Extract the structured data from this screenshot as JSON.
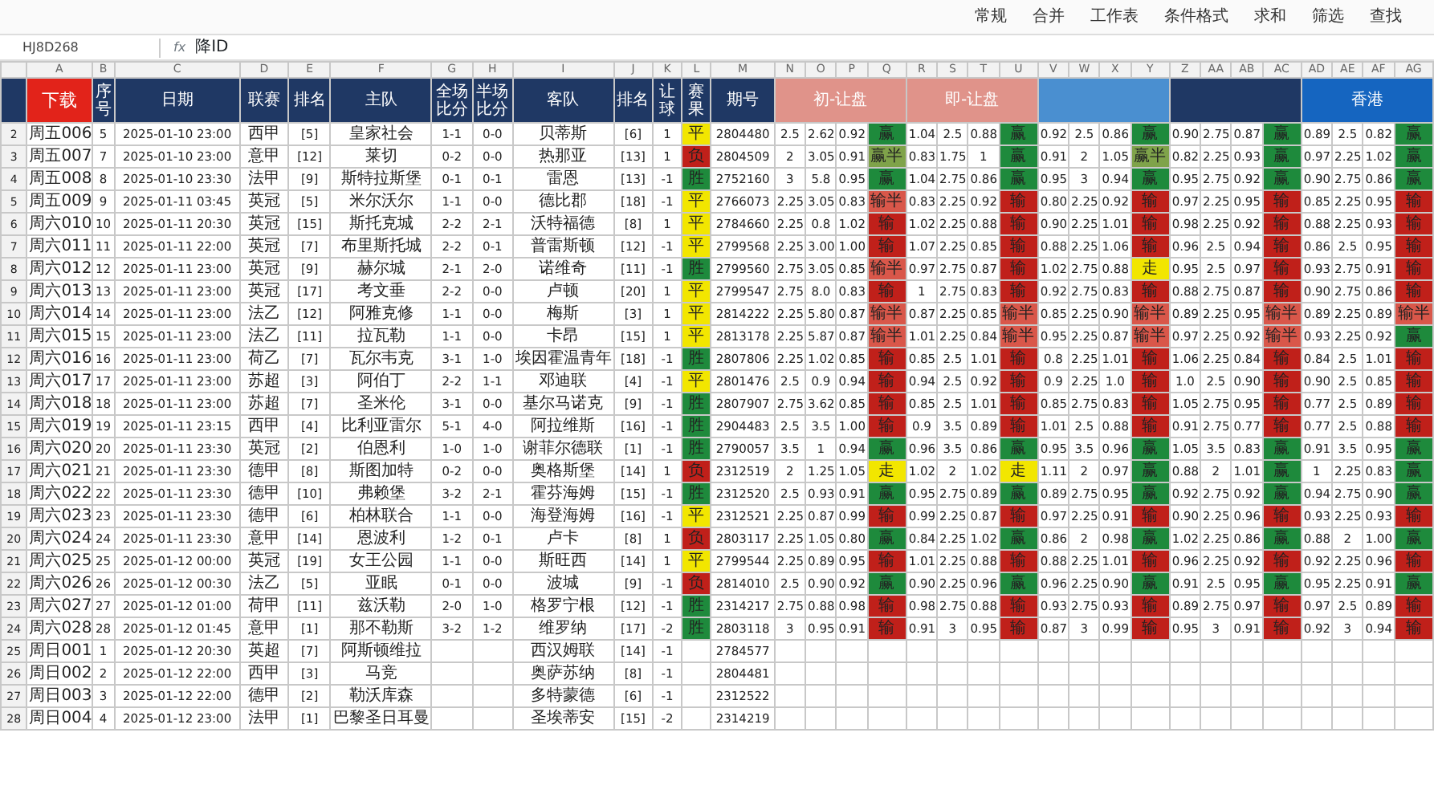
{
  "toolbar": {
    "items": [
      "常规",
      "合并",
      "工作表",
      "条件格式",
      "求和",
      "筛选",
      "查找"
    ]
  },
  "formula_bar": {
    "name_box": "HJ8D268",
    "fx": "fx",
    "value": "降ID"
  },
  "col_letters": [
    "A",
    "B",
    "C",
    "D",
    "E",
    "F",
    "G",
    "H",
    "I",
    "J",
    "K",
    "L",
    "M",
    "N",
    "O",
    "P",
    "Q",
    "R",
    "S",
    "T",
    "U",
    "V",
    "W",
    "X",
    "Y",
    "Z",
    "AA",
    "AB",
    "AC",
    "AD",
    "AE",
    "AF",
    "AG"
  ],
  "header": {
    "download": "下载",
    "columns": [
      "序号",
      "日期",
      "联赛",
      "排名",
      "主队",
      "全场比分",
      "半场比分",
      "客队",
      "排名",
      "让球",
      "赛果",
      "期号"
    ],
    "groups": [
      {
        "label": "初-让盘",
        "color": "#e0938a"
      },
      {
        "label": "即-让盘",
        "color": "#e0938a"
      },
      {
        "color": "#4a8fd0"
      },
      {
        "color": "#1f3864"
      },
      {
        "label": "香港",
        "color": "#1565c0"
      }
    ]
  },
  "rows": [
    {
      "n": "2",
      "code": "周五006",
      "no": "5",
      "date": "2025-01-10 23:00",
      "lg": "西甲",
      "hr": "[5]",
      "home": "皇家社会",
      "ft": "1-1",
      "ht": "0-0",
      "away": "贝蒂斯",
      "ar": "[6]",
      "hcp": "1",
      "result": {
        "t": "平",
        "color": "#f2e600"
      },
      "issue": "2804480",
      "g": [
        {
          "v": [
            "2.5",
            "2.62",
            "0.92"
          ],
          "t": "赢",
          "color": "#1e8a3c"
        },
        {
          "v": [
            "1.04",
            "2.5",
            "0.88"
          ],
          "t": "赢",
          "color": "#1e8a3c"
        },
        {
          "v": [
            "0.92",
            "2.5",
            "0.86"
          ],
          "t": "赢",
          "color": "#1e8a3c"
        },
        {
          "v": [
            "0.90",
            "2.75",
            "0.87"
          ],
          "t": "赢",
          "color": "#1e8a3c"
        },
        {
          "v": [
            "0.89",
            "2.5",
            "0.82"
          ],
          "t": "赢",
          "color": "#1e8a3c"
        }
      ]
    },
    {
      "n": "3",
      "code": "周五007",
      "no": "7",
      "date": "2025-01-10 23:00",
      "lg": "意甲",
      "hr": "[12]",
      "home": "莱切",
      "ft": "0-2",
      "ht": "0-0",
      "away": "热那亚",
      "ar": "[13]",
      "hcp": "1",
      "result": {
        "t": "负",
        "color": "#c0201a"
      },
      "issue": "2804509",
      "g": [
        {
          "v": [
            "2",
            "3.05",
            "0.91"
          ],
          "t": "赢半",
          "color": "#7fa34a"
        },
        {
          "v": [
            "0.83",
            "1.75",
            "1"
          ],
          "t": "赢",
          "color": "#1e8a3c"
        },
        {
          "v": [
            "0.91",
            "2",
            "1.05"
          ],
          "t": "赢半",
          "color": "#7fa34a"
        },
        {
          "v": [
            "0.82",
            "2.25",
            "0.93"
          ],
          "t": "赢",
          "color": "#1e8a3c"
        },
        {
          "v": [
            "0.97",
            "2.25",
            "1.02"
          ],
          "t": "赢",
          "color": "#1e8a3c"
        }
      ]
    },
    {
      "n": "4",
      "code": "周五008",
      "no": "8",
      "date": "2025-01-10 23:30",
      "lg": "法甲",
      "hr": "[9]",
      "home": "斯特拉斯堡",
      "ft": "0-1",
      "ht": "0-1",
      "away": "雷恩",
      "ar": "[13]",
      "hcp": "-1",
      "result": {
        "t": "胜",
        "color": "#1e8a3c"
      },
      "issue": "2752160",
      "g": [
        {
          "v": [
            "3",
            "5.8",
            "0.95"
          ],
          "t": "赢",
          "color": "#1e8a3c"
        },
        {
          "v": [
            "1.04",
            "2.75",
            "0.86"
          ],
          "t": "赢",
          "color": "#1e8a3c"
        },
        {
          "v": [
            "0.95",
            "3",
            "0.94"
          ],
          "t": "赢",
          "color": "#1e8a3c"
        },
        {
          "v": [
            "0.95",
            "2.75",
            "0.92"
          ],
          "t": "赢",
          "color": "#1e8a3c"
        },
        {
          "v": [
            "0.90",
            "2.75",
            "0.86"
          ],
          "t": "赢",
          "color": "#1e8a3c"
        }
      ]
    },
    {
      "n": "5",
      "code": "周五009",
      "no": "9",
      "date": "2025-01-11 03:45",
      "lg": "英冠",
      "hr": "[5]",
      "home": "米尔沃尔",
      "ft": "1-1",
      "ht": "0-0",
      "away": "德比郡",
      "ar": "[18]",
      "hcp": "-1",
      "result": {
        "t": "平",
        "color": "#f2e600"
      },
      "issue": "2766073",
      "g": [
        {
          "v": [
            "2.25",
            "3.05",
            "0.83"
          ],
          "t": "输半",
          "color": "#d9574a"
        },
        {
          "v": [
            "0.83",
            "2.25",
            "0.92"
          ],
          "t": "输",
          "color": "#c0201a"
        },
        {
          "v": [
            "0.80",
            "2.25",
            "0.92"
          ],
          "t": "输",
          "color": "#c0201a"
        },
        {
          "v": [
            "0.97",
            "2.25",
            "0.95"
          ],
          "t": "输",
          "color": "#c0201a"
        },
        {
          "v": [
            "0.85",
            "2.25",
            "0.95"
          ],
          "t": "输",
          "color": "#c0201a"
        }
      ]
    },
    {
      "n": "6",
      "code": "周六010",
      "no": "10",
      "date": "2025-01-11 20:30",
      "lg": "英冠",
      "hr": "[15]",
      "home": "斯托克城",
      "ft": "2-2",
      "ht": "2-1",
      "away": "沃特福德",
      "ar": "[8]",
      "hcp": "1",
      "result": {
        "t": "平",
        "color": "#f2e600"
      },
      "issue": "2784660",
      "g": [
        {
          "v": [
            "2.25",
            "0.8",
            "1.02"
          ],
          "t": "输",
          "color": "#c0201a"
        },
        {
          "v": [
            "1.02",
            "2.25",
            "0.88"
          ],
          "t": "输",
          "color": "#c0201a"
        },
        {
          "v": [
            "0.90",
            "2.25",
            "1.01"
          ],
          "t": "输",
          "color": "#c0201a"
        },
        {
          "v": [
            "0.98",
            "2.25",
            "0.92"
          ],
          "t": "输",
          "color": "#c0201a"
        },
        {
          "v": [
            "0.88",
            "2.25",
            "0.93"
          ],
          "t": "输",
          "color": "#c0201a"
        }
      ]
    },
    {
      "n": "7",
      "code": "周六011",
      "no": "11",
      "date": "2025-01-11 22:00",
      "lg": "英冠",
      "hr": "[7]",
      "home": "布里斯托城",
      "ft": "2-2",
      "ht": "0-1",
      "away": "普雷斯顿",
      "ar": "[12]",
      "hcp": "-1",
      "result": {
        "t": "平",
        "color": "#f2e600"
      },
      "issue": "2799568",
      "g": [
        {
          "v": [
            "2.25",
            "3.00",
            "1.00"
          ],
          "t": "输",
          "color": "#c0201a"
        },
        {
          "v": [
            "1.07",
            "2.25",
            "0.85"
          ],
          "t": "输",
          "color": "#c0201a"
        },
        {
          "v": [
            "0.88",
            "2.25",
            "1.06"
          ],
          "t": "输",
          "color": "#c0201a"
        },
        {
          "v": [
            "0.96",
            "2.5",
            "0.94"
          ],
          "t": "输",
          "color": "#c0201a"
        },
        {
          "v": [
            "0.86",
            "2.5",
            "0.95"
          ],
          "t": "输",
          "color": "#c0201a"
        }
      ]
    },
    {
      "n": "8",
      "code": "周六012",
      "no": "12",
      "date": "2025-01-11 23:00",
      "lg": "英冠",
      "hr": "[9]",
      "home": "赫尔城",
      "ft": "2-1",
      "ht": "2-0",
      "away": "诺维奇",
      "ar": "[11]",
      "hcp": "-1",
      "result": {
        "t": "胜",
        "color": "#1e8a3c"
      },
      "issue": "2799560",
      "g": [
        {
          "v": [
            "2.75",
            "3.05",
            "0.85"
          ],
          "t": "输半",
          "color": "#d9574a"
        },
        {
          "v": [
            "0.97",
            "2.75",
            "0.87"
          ],
          "t": "输",
          "color": "#c0201a"
        },
        {
          "v": [
            "1.02",
            "2.75",
            "0.88"
          ],
          "t": "走",
          "color": "#f2e600"
        },
        {
          "v": [
            "0.95",
            "2.5",
            "0.97"
          ],
          "t": "输",
          "color": "#c0201a"
        },
        {
          "v": [
            "0.93",
            "2.75",
            "0.91"
          ],
          "t": "输",
          "color": "#c0201a"
        }
      ]
    },
    {
      "n": "9",
      "code": "周六013",
      "no": "13",
      "date": "2025-01-11 23:00",
      "lg": "英冠",
      "hr": "[17]",
      "home": "考文垂",
      "ft": "2-2",
      "ht": "0-0",
      "away": "卢顿",
      "ar": "[20]",
      "hcp": "1",
      "result": {
        "t": "平",
        "color": "#f2e600"
      },
      "issue": "2799547",
      "g": [
        {
          "v": [
            "2.75",
            "8.0",
            "0.83"
          ],
          "t": "输",
          "color": "#c0201a"
        },
        {
          "v": [
            "1",
            "2.75",
            "0.83"
          ],
          "t": "输",
          "color": "#c0201a"
        },
        {
          "v": [
            "0.92",
            "2.75",
            "0.83"
          ],
          "t": "输",
          "color": "#c0201a"
        },
        {
          "v": [
            "0.88",
            "2.75",
            "0.87"
          ],
          "t": "输",
          "color": "#c0201a"
        },
        {
          "v": [
            "0.90",
            "2.75",
            "0.86"
          ],
          "t": "输",
          "color": "#c0201a"
        }
      ]
    },
    {
      "n": "10",
      "code": "周六014",
      "no": "14",
      "date": "2025-01-11 23:00",
      "lg": "法乙",
      "hr": "[12]",
      "home": "阿雅克修",
      "ft": "1-1",
      "ht": "0-0",
      "away": "梅斯",
      "ar": "[3]",
      "hcp": "1",
      "result": {
        "t": "平",
        "color": "#f2e600"
      },
      "issue": "2814222",
      "g": [
        {
          "v": [
            "2.25",
            "5.80",
            "0.87"
          ],
          "t": "输半",
          "color": "#d9574a"
        },
        {
          "v": [
            "0.87",
            "2.25",
            "0.85"
          ],
          "t": "输半",
          "color": "#d9574a"
        },
        {
          "v": [
            "0.85",
            "2.25",
            "0.90"
          ],
          "t": "输半",
          "color": "#d9574a"
        },
        {
          "v": [
            "0.89",
            "2.25",
            "0.95"
          ],
          "t": "输半",
          "color": "#d9574a"
        },
        {
          "v": [
            "0.89",
            "2.25",
            "0.89"
          ],
          "t": "输半",
          "color": "#d9574a"
        }
      ]
    },
    {
      "n": "11",
      "code": "周六015",
      "no": "15",
      "date": "2025-01-11 23:00",
      "lg": "法乙",
      "hr": "[11]",
      "home": "拉瓦勒",
      "ft": "1-1",
      "ht": "0-0",
      "away": "卡昂",
      "ar": "[15]",
      "hcp": "1",
      "result": {
        "t": "平",
        "color": "#f2e600"
      },
      "issue": "2813178",
      "g": [
        {
          "v": [
            "2.25",
            "5.87",
            "0.87"
          ],
          "t": "输半",
          "color": "#d9574a"
        },
        {
          "v": [
            "1.01",
            "2.25",
            "0.84"
          ],
          "t": "输半",
          "color": "#d9574a"
        },
        {
          "v": [
            "0.95",
            "2.25",
            "0.87"
          ],
          "t": "输半",
          "color": "#d9574a"
        },
        {
          "v": [
            "0.97",
            "2.25",
            "0.92"
          ],
          "t": "输半",
          "color": "#d9574a"
        },
        {
          "v": [
            "0.93",
            "2.25",
            "0.92"
          ],
          "t": "赢",
          "color": "#1e8a3c"
        }
      ]
    },
    {
      "n": "12",
      "code": "周六016",
      "no": "16",
      "date": "2025-01-11 23:00",
      "lg": "荷乙",
      "hr": "[7]",
      "home": "瓦尔韦克",
      "ft": "3-1",
      "ht": "1-0",
      "away": "埃因霍温青年",
      "ar": "[18]",
      "hcp": "-1",
      "result": {
        "t": "胜",
        "color": "#1e8a3c"
      },
      "issue": "2807806",
      "g": [
        {
          "v": [
            "2.25",
            "1.02",
            "0.85"
          ],
          "t": "输",
          "color": "#c0201a"
        },
        {
          "v": [
            "0.85",
            "2.5",
            "1.01"
          ],
          "t": "输",
          "color": "#c0201a"
        },
        {
          "v": [
            "0.8",
            "2.25",
            "1.01"
          ],
          "t": "输",
          "color": "#c0201a"
        },
        {
          "v": [
            "1.06",
            "2.25",
            "0.84"
          ],
          "t": "输",
          "color": "#c0201a"
        },
        {
          "v": [
            "0.84",
            "2.5",
            "1.01"
          ],
          "t": "输",
          "color": "#c0201a"
        }
      ]
    },
    {
      "n": "13",
      "code": "周六017",
      "no": "17",
      "date": "2025-01-11 23:00",
      "lg": "苏超",
      "hr": "[3]",
      "home": "阿伯丁",
      "ft": "2-2",
      "ht": "1-1",
      "away": "邓迪联",
      "ar": "[4]",
      "hcp": "-1",
      "result": {
        "t": "平",
        "color": "#f2e600"
      },
      "issue": "2801476",
      "g": [
        {
          "v": [
            "2.5",
            "0.9",
            "0.94"
          ],
          "t": "输",
          "color": "#c0201a"
        },
        {
          "v": [
            "0.94",
            "2.5",
            "0.92"
          ],
          "t": "输",
          "color": "#c0201a"
        },
        {
          "v": [
            "0.9",
            "2.25",
            "1.0"
          ],
          "t": "输",
          "color": "#c0201a"
        },
        {
          "v": [
            "1.0",
            "2.5",
            "0.90"
          ],
          "t": "输",
          "color": "#c0201a"
        },
        {
          "v": [
            "0.90",
            "2.5",
            "0.85"
          ],
          "t": "输",
          "color": "#c0201a"
        }
      ]
    },
    {
      "n": "14",
      "code": "周六018",
      "no": "18",
      "date": "2025-01-11 23:00",
      "lg": "苏超",
      "hr": "[7]",
      "home": "圣米伦",
      "ft": "3-1",
      "ht": "0-0",
      "away": "基尔马诺克",
      "ar": "[9]",
      "hcp": "-1",
      "result": {
        "t": "胜",
        "color": "#1e8a3c"
      },
      "issue": "2807907",
      "g": [
        {
          "v": [
            "2.75",
            "3.62",
            "0.85"
          ],
          "t": "输",
          "color": "#c0201a"
        },
        {
          "v": [
            "0.85",
            "2.5",
            "1.01"
          ],
          "t": "输",
          "color": "#c0201a"
        },
        {
          "v": [
            "0.85",
            "2.75",
            "0.83"
          ],
          "t": "输",
          "color": "#c0201a"
        },
        {
          "v": [
            "1.05",
            "2.75",
            "0.95"
          ],
          "t": "输",
          "color": "#c0201a"
        },
        {
          "v": [
            "0.77",
            "2.5",
            "0.89"
          ],
          "t": "输",
          "color": "#c0201a"
        }
      ]
    },
    {
      "n": "15",
      "code": "周六019",
      "no": "19",
      "date": "2025-01-11 23:15",
      "lg": "西甲",
      "hr": "[4]",
      "home": "比利亚雷尔",
      "ft": "5-1",
      "ht": "4-0",
      "away": "阿拉维斯",
      "ar": "[16]",
      "hcp": "-1",
      "result": {
        "t": "胜",
        "color": "#1e8a3c"
      },
      "issue": "2904483",
      "g": [
        {
          "v": [
            "2.5",
            "3.5",
            "1.00"
          ],
          "t": "输",
          "color": "#c0201a"
        },
        {
          "v": [
            "0.9",
            "3.5",
            "0.89"
          ],
          "t": "输",
          "color": "#c0201a"
        },
        {
          "v": [
            "1.01",
            "2.5",
            "0.88"
          ],
          "t": "输",
          "color": "#c0201a"
        },
        {
          "v": [
            "0.91",
            "2.75",
            "0.77"
          ],
          "t": "输",
          "color": "#c0201a"
        },
        {
          "v": [
            "0.77",
            "2.5",
            "0.88"
          ],
          "t": "输",
          "color": "#c0201a"
        }
      ]
    },
    {
      "n": "16",
      "code": "周六020",
      "no": "20",
      "date": "2025-01-11 23:30",
      "lg": "英冠",
      "hr": "[2]",
      "home": "伯恩利",
      "ft": "1-0",
      "ht": "1-0",
      "away": "谢菲尔德联",
      "ar": "[1]",
      "hcp": "-1",
      "result": {
        "t": "胜",
        "color": "#1e8a3c"
      },
      "issue": "2790057",
      "g": [
        {
          "v": [
            "3.5",
            "1",
            "0.94"
          ],
          "t": "赢",
          "color": "#1e8a3c"
        },
        {
          "v": [
            "0.96",
            "3.5",
            "0.86"
          ],
          "t": "赢",
          "color": "#1e8a3c"
        },
        {
          "v": [
            "0.95",
            "3.5",
            "0.96"
          ],
          "t": "赢",
          "color": "#1e8a3c"
        },
        {
          "v": [
            "1.05",
            "3.5",
            "0.83"
          ],
          "t": "赢",
          "color": "#1e8a3c"
        },
        {
          "v": [
            "0.91",
            "3.5",
            "0.95"
          ],
          "t": "赢",
          "color": "#1e8a3c"
        }
      ]
    },
    {
      "n": "17",
      "code": "周六021",
      "no": "21",
      "date": "2025-01-11 23:30",
      "lg": "德甲",
      "hr": "[8]",
      "home": "斯图加特",
      "ft": "0-2",
      "ht": "0-0",
      "away": "奥格斯堡",
      "ar": "[14]",
      "hcp": "1",
      "result": {
        "t": "负",
        "color": "#c0201a"
      },
      "issue": "2312519",
      "g": [
        {
          "v": [
            "2",
            "1.25",
            "1.05"
          ],
          "t": "走",
          "color": "#f2e600"
        },
        {
          "v": [
            "1.02",
            "2",
            "1.02"
          ],
          "t": "走",
          "color": "#f2e600"
        },
        {
          "v": [
            "1.11",
            "2",
            "0.97"
          ],
          "t": "赢",
          "color": "#1e8a3c"
        },
        {
          "v": [
            "0.88",
            "2",
            "1.01"
          ],
          "t": "赢",
          "color": "#1e8a3c"
        },
        {
          "v": [
            "1",
            "2.25",
            "0.83"
          ],
          "t": "赢",
          "color": "#1e8a3c"
        }
      ]
    },
    {
      "n": "18",
      "code": "周六022",
      "no": "22",
      "date": "2025-01-11 23:30",
      "lg": "德甲",
      "hr": "[10]",
      "home": "弗赖堡",
      "ft": "3-2",
      "ht": "2-1",
      "away": "霍芬海姆",
      "ar": "[15]",
      "hcp": "-1",
      "result": {
        "t": "胜",
        "color": "#1e8a3c"
      },
      "issue": "2312520",
      "g": [
        {
          "v": [
            "2.5",
            "0.93",
            "0.91"
          ],
          "t": "赢",
          "color": "#1e8a3c"
        },
        {
          "v": [
            "0.95",
            "2.75",
            "0.89"
          ],
          "t": "赢",
          "color": "#1e8a3c"
        },
        {
          "v": [
            "0.89",
            "2.75",
            "0.95"
          ],
          "t": "赢",
          "color": "#1e8a3c"
        },
        {
          "v": [
            "0.92",
            "2.75",
            "0.92"
          ],
          "t": "赢",
          "color": "#1e8a3c"
        },
        {
          "v": [
            "0.94",
            "2.75",
            "0.90"
          ],
          "t": "赢",
          "color": "#1e8a3c"
        }
      ]
    },
    {
      "n": "19",
      "code": "周六023",
      "no": "23",
      "date": "2025-01-11 23:30",
      "lg": "德甲",
      "hr": "[6]",
      "home": "柏林联合",
      "ft": "1-1",
      "ht": "0-0",
      "away": "海登海姆",
      "ar": "[16]",
      "hcp": "-1",
      "result": {
        "t": "平",
        "color": "#f2e600"
      },
      "issue": "2312521",
      "g": [
        {
          "v": [
            "2.25",
            "0.87",
            "0.99"
          ],
          "t": "输",
          "color": "#c0201a"
        },
        {
          "v": [
            "0.99",
            "2.25",
            "0.87"
          ],
          "t": "输",
          "color": "#c0201a"
        },
        {
          "v": [
            "0.97",
            "2.25",
            "0.91"
          ],
          "t": "输",
          "color": "#c0201a"
        },
        {
          "v": [
            "0.90",
            "2.25",
            "0.96"
          ],
          "t": "输",
          "color": "#c0201a"
        },
        {
          "v": [
            "0.93",
            "2.25",
            "0.93"
          ],
          "t": "输",
          "color": "#c0201a"
        }
      ]
    },
    {
      "n": "20",
      "code": "周六024",
      "no": "24",
      "date": "2025-01-11 23:30",
      "lg": "意甲",
      "hr": "[14]",
      "home": "恩波利",
      "ft": "1-2",
      "ht": "0-1",
      "away": "卢卡",
      "ar": "[8]",
      "hcp": "1",
      "result": {
        "t": "负",
        "color": "#c0201a"
      },
      "issue": "2803117",
      "g": [
        {
          "v": [
            "2.25",
            "1.05",
            "0.80"
          ],
          "t": "赢",
          "color": "#1e8a3c"
        },
        {
          "v": [
            "0.84",
            "2.25",
            "1.02"
          ],
          "t": "赢",
          "color": "#1e8a3c"
        },
        {
          "v": [
            "0.86",
            "2",
            "0.98"
          ],
          "t": "赢",
          "color": "#1e8a3c"
        },
        {
          "v": [
            "1.02",
            "2.25",
            "0.86"
          ],
          "t": "赢",
          "color": "#1e8a3c"
        },
        {
          "v": [
            "0.88",
            "2",
            "1.00"
          ],
          "t": "赢",
          "color": "#1e8a3c"
        }
      ]
    },
    {
      "n": "21",
      "code": "周六025",
      "no": "25",
      "date": "2025-01-12 00:00",
      "lg": "英冠",
      "hr": "[19]",
      "home": "女王公园",
      "ft": "1-1",
      "ht": "0-0",
      "away": "斯旺西",
      "ar": "[14]",
      "hcp": "1",
      "result": {
        "t": "平",
        "color": "#f2e600"
      },
      "issue": "2799544",
      "g": [
        {
          "v": [
            "2.25",
            "0.89",
            "0.95"
          ],
          "t": "输",
          "color": "#c0201a"
        },
        {
          "v": [
            "1.01",
            "2.25",
            "0.88"
          ],
          "t": "输",
          "color": "#c0201a"
        },
        {
          "v": [
            "0.88",
            "2.25",
            "1.01"
          ],
          "t": "输",
          "color": "#c0201a"
        },
        {
          "v": [
            "0.96",
            "2.25",
            "0.92"
          ],
          "t": "输",
          "color": "#c0201a"
        },
        {
          "v": [
            "0.92",
            "2.25",
            "0.96"
          ],
          "t": "输",
          "color": "#c0201a"
        }
      ]
    },
    {
      "n": "22",
      "code": "周六026",
      "no": "26",
      "date": "2025-01-12 00:30",
      "lg": "法乙",
      "hr": "[5]",
      "home": "亚眠",
      "ft": "0-1",
      "ht": "0-0",
      "away": "波城",
      "ar": "[9]",
      "hcp": "-1",
      "result": {
        "t": "负",
        "color": "#c0201a"
      },
      "issue": "2814010",
      "g": [
        {
          "v": [
            "2.5",
            "0.90",
            "0.92"
          ],
          "t": "赢",
          "color": "#1e8a3c"
        },
        {
          "v": [
            "0.90",
            "2.25",
            "0.96"
          ],
          "t": "赢",
          "color": "#1e8a3c"
        },
        {
          "v": [
            "0.96",
            "2.25",
            "0.90"
          ],
          "t": "赢",
          "color": "#1e8a3c"
        },
        {
          "v": [
            "0.91",
            "2.5",
            "0.95"
          ],
          "t": "赢",
          "color": "#1e8a3c"
        },
        {
          "v": [
            "0.95",
            "2.25",
            "0.91"
          ],
          "t": "赢",
          "color": "#1e8a3c"
        }
      ]
    },
    {
      "n": "23",
      "code": "周六027",
      "no": "27",
      "date": "2025-01-12 01:00",
      "lg": "荷甲",
      "hr": "[11]",
      "home": "兹沃勒",
      "ft": "2-0",
      "ht": "1-0",
      "away": "格罗宁根",
      "ar": "[12]",
      "hcp": "-1",
      "result": {
        "t": "胜",
        "color": "#1e8a3c"
      },
      "issue": "2314217",
      "g": [
        {
          "v": [
            "2.75",
            "0.88",
            "0.98"
          ],
          "t": "输",
          "color": "#c0201a"
        },
        {
          "v": [
            "0.98",
            "2.75",
            "0.88"
          ],
          "t": "输",
          "color": "#c0201a"
        },
        {
          "v": [
            "0.93",
            "2.75",
            "0.93"
          ],
          "t": "输",
          "color": "#c0201a"
        },
        {
          "v": [
            "0.89",
            "2.75",
            "0.97"
          ],
          "t": "输",
          "color": "#c0201a"
        },
        {
          "v": [
            "0.97",
            "2.5",
            "0.89"
          ],
          "t": "输",
          "color": "#c0201a"
        }
      ]
    },
    {
      "n": "24",
      "code": "周六028",
      "no": "28",
      "date": "2025-01-12 01:45",
      "lg": "意甲",
      "hr": "[1]",
      "home": "那不勒斯",
      "ft": "3-2",
      "ht": "1-2",
      "away": "维罗纳",
      "ar": "[17]",
      "hcp": "-2",
      "result": {
        "t": "胜",
        "color": "#1e8a3c"
      },
      "issue": "2803118",
      "g": [
        {
          "v": [
            "3",
            "0.95",
            "0.91"
          ],
          "t": "输",
          "color": "#c0201a"
        },
        {
          "v": [
            "0.91",
            "3",
            "0.95"
          ],
          "t": "输",
          "color": "#c0201a"
        },
        {
          "v": [
            "0.87",
            "3",
            "0.99"
          ],
          "t": "输",
          "color": "#c0201a"
        },
        {
          "v": [
            "0.95",
            "3",
            "0.91"
          ],
          "t": "输",
          "color": "#c0201a"
        },
        {
          "v": [
            "0.92",
            "3",
            "0.94"
          ],
          "t": "输",
          "color": "#c0201a"
        }
      ]
    },
    {
      "n": "25",
      "code": "周日001",
      "no": "1",
      "date": "2025-01-12 20:30",
      "lg": "英超",
      "hr": "[7]",
      "home": "阿斯顿维拉",
      "away": "西汉姆联",
      "ar": "[14]",
      "hcp": "-1",
      "issue": "2784577"
    },
    {
      "n": "26",
      "code": "周日002",
      "no": "2",
      "date": "2025-01-12 22:00",
      "lg": "西甲",
      "hr": "[3]",
      "home": "马竞",
      "away": "奥萨苏纳",
      "ar": "[8]",
      "hcp": "-1",
      "issue": "2804481"
    },
    {
      "n": "27",
      "code": "周日003",
      "no": "3",
      "date": "2025-01-12 22:00",
      "lg": "德甲",
      "hr": "[2]",
      "home": "勒沃库森",
      "away": "多特蒙德",
      "ar": "[6]",
      "hcp": "-1",
      "issue": "2312522"
    },
    {
      "n": "28",
      "code": "周日004",
      "no": "4",
      "date": "2025-01-12 23:00",
      "lg": "法甲",
      "hr": "[1]",
      "home": "巴黎圣日耳曼",
      "away": "圣埃蒂安",
      "ar": "[15]",
      "hcp": "-2",
      "issue": "2314219"
    }
  ]
}
